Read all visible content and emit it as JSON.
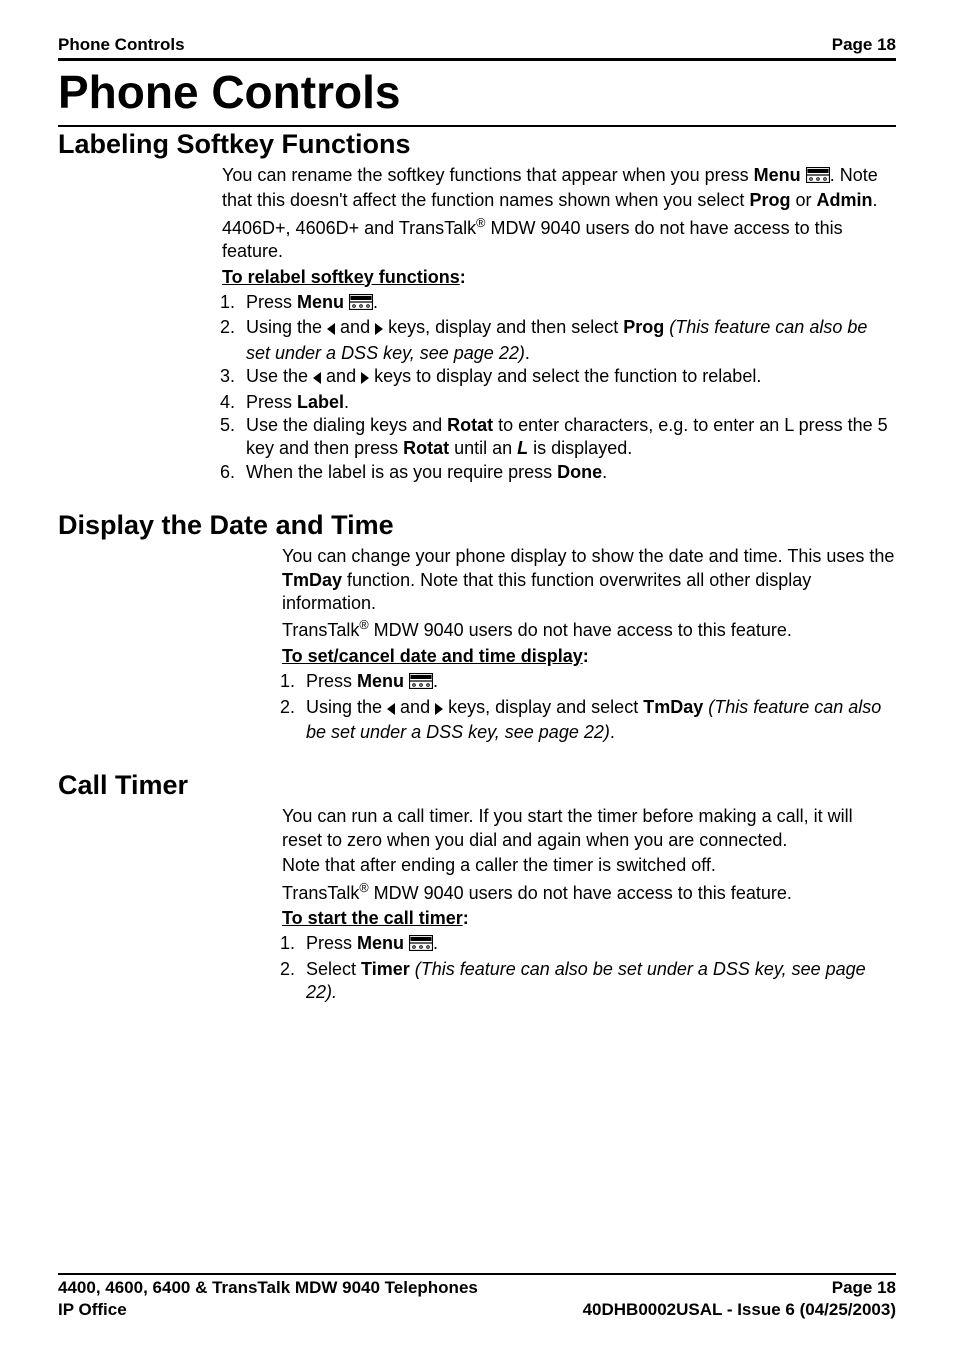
{
  "header": {
    "left": "Phone Controls",
    "right": "Page 18"
  },
  "title": "Phone Controls",
  "sections": {
    "labeling": {
      "heading": "Labeling Softkey Functions",
      "intro1_pre": "You can rename the softkey functions that appear when you press ",
      "intro1_menu": "Menu",
      "intro1_post": ". Note that this doesn't affect the function names shown when you select ",
      "intro1_prog": "Prog",
      "intro1_or": " or ",
      "intro1_admin": "Admin",
      "intro1_end": ".",
      "intro2_a": "4406D+, 4606D+ and TransTalk",
      "intro2_b": " MDW 9040 users do not have access to this feature.",
      "subhead": "To relabel softkey functions",
      "step1_a": "Press ",
      "step1_b": "Menu",
      "step1_c": ".",
      "step2_a": "Using the ",
      "step2_b": " and ",
      "step2_c": " keys, display and then select ",
      "step2_d": "Prog",
      "step2_e": " (This feature can also be set under a DSS key, see page 22)",
      "step2_f": ".",
      "step3_a": "Use the ",
      "step3_b": " and ",
      "step3_c": " keys to display and select the function to relabel.",
      "step4_a": "Press ",
      "step4_b": "Label",
      "step4_c": ".",
      "step5_a": "Use the dialing keys and ",
      "step5_b": "Rotat",
      "step5_c": " to enter characters, e.g. to enter an L press the 5 key and then press ",
      "step5_d": "Rotat",
      "step5_e": " until an ",
      "step5_f": "L",
      "step5_g": " is displayed.",
      "step6_a": "When the label is as you require press ",
      "step6_b": "Done",
      "step6_c": "."
    },
    "datetime": {
      "heading": "Display the Date and Time",
      "intro1_a": "You can change your phone display to show the date and time. This uses the ",
      "intro1_b": "TmDay",
      "intro1_c": " function. Note that this function overwrites all other display information.",
      "intro2_a": "TransTalk",
      "intro2_b": " MDW 9040 users do not have access to this feature.",
      "subhead": "To set/cancel date and time display",
      "step1_a": "Press ",
      "step1_b": "Menu",
      "step1_c": ".",
      "step2_a": "Using the ",
      "step2_b": " and ",
      "step2_c": " keys, display and select ",
      "step2_d": "TmDay",
      "step2_e": " (This feature can also be set under a DSS key, see page 22)",
      "step2_f": "."
    },
    "timer": {
      "heading": "Call Timer",
      "intro1": "You can run a call timer. If you start the timer before making a call, it will reset to zero when you dial and again when you are connected.",
      "intro2": "Note that after ending a caller the timer is switched off.",
      "intro3_a": "TransTalk",
      "intro3_b": " MDW 9040 users do not have access to this feature.",
      "subhead": "To start the call timer",
      "step1_a": "Press ",
      "step1_b": "Menu",
      "step1_c": ".",
      "step2_a": "Select ",
      "step2_b": "Timer",
      "step2_c": " (This feature can also be set under a DSS key, see page 22).",
      "step2_d": ""
    }
  },
  "footer": {
    "row1_left": "4400, 4600, 6400 & TransTalk MDW 9040 Telephones",
    "row1_right": "Page 18",
    "row2_left": "IP Office",
    "row2_right": "40DHB0002USAL - Issue 6 (04/25/2003)"
  },
  "icons": {
    "menu": "menu-icon",
    "left_arrow": "left-arrow-icon",
    "right_arrow": "right-arrow-icon"
  }
}
